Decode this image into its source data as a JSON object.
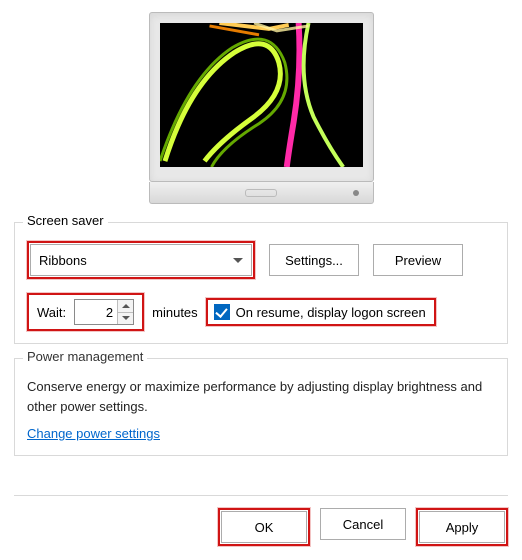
{
  "group_screensaver": {
    "title": "Screen saver",
    "dropdown_value": "Ribbons",
    "settings_btn": "Settings...",
    "preview_btn": "Preview",
    "wait_label": "Wait:",
    "wait_value": "2",
    "minutes_label": "minutes",
    "resume_label": "On resume, display logon screen",
    "resume_checked": true
  },
  "group_power": {
    "title": "Power management",
    "text": "Conserve energy or maximize performance by adjusting display brightness and other power settings.",
    "link": "Change power settings"
  },
  "footer": {
    "ok": "OK",
    "cancel": "Cancel",
    "apply": "Apply"
  }
}
